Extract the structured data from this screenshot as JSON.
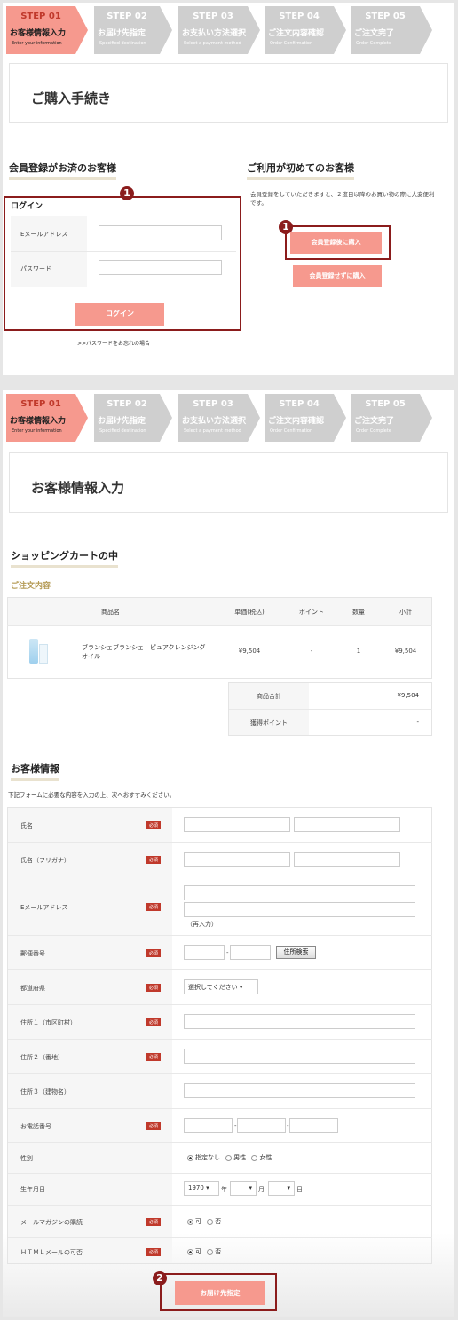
{
  "steps": [
    {
      "num": "STEP 01",
      "ja": "お客様情報入力",
      "en": "Enter your information"
    },
    {
      "num": "STEP 02",
      "ja": "お届け先指定",
      "en": "Specified destination"
    },
    {
      "num": "STEP 03",
      "ja": "お支払い方法選択",
      "en": "Select a payment method"
    },
    {
      "num": "STEP 04",
      "ja": "ご注文内容確認",
      "en": "Order Confirmation"
    },
    {
      "num": "STEP 05",
      "ja": "ご注文完了",
      "en": "Order Complete"
    }
  ],
  "colors": {
    "accent": "#f6998e",
    "highlight": "#8b1c1c",
    "underline": "#e9e2cf"
  },
  "top": {
    "title": "ご購入手続き",
    "member_heading": "会員登録がお済のお客様",
    "new_heading": "ご利用が初めてのお客様",
    "login_heading": "ログイン",
    "email_label": "Eメールアドレス",
    "password_label": "パスワード",
    "login_button": "ログイン",
    "forgot_link": ">>パスワードをお忘れの場合",
    "new_desc": "会員登録をしていただきますと、２度目以降のお買い物の際に大変便利です。",
    "register_button": "会員登録後に購入",
    "guest_button": "会員登録せずに購入",
    "badge1": "1",
    "badge2": "1"
  },
  "bottom": {
    "title": "お客様情報入力",
    "cart_heading": "ショッピングカートの中",
    "order_subheading": "ご注文内容",
    "cart_headers": [
      "商品名",
      "単価(税込)",
      "ポイント",
      "数量",
      "小計"
    ],
    "cart_item": {
      "name": "ブランシェブランシェ　ピュアクレンジングオイル",
      "price": "¥9,504",
      "points": "-",
      "qty": "1",
      "subtotal": "¥9,504"
    },
    "total_label": "商品合計",
    "total_value": "¥9,504",
    "points_label": "獲得ポイント",
    "points_value": "-",
    "customer_heading": "お客様情報",
    "instruction": "下記フォームに必要な内容を入力の上、次へおすすみください。",
    "required": "必須",
    "fields": {
      "name": "氏名",
      "kana": "氏名（フリガナ）",
      "email": "Eメールアドレス",
      "email_re": "（再入力）",
      "zip": "郵便番号",
      "zip_sep": "-",
      "zip_button": "住所検索",
      "pref": "都道府県",
      "pref_select": "選択してください",
      "addr1": "住所１（市区町村）",
      "addr2": "住所２（番地）",
      "addr3": "住所３（建物名）",
      "tel": "お電話番号",
      "tel_sep": "-",
      "gender": "性別",
      "gender_opts": [
        "指定なし",
        "男性",
        "女性"
      ],
      "birth": "生年月日",
      "birth_year": "1970",
      "birth_year_unit": "年",
      "birth_month_unit": "月",
      "birth_day_unit": "日",
      "magazine": "メールマガジンの購読",
      "html_mail": "ＨＴＭＬメールの可否",
      "yes": "可",
      "no": "否"
    },
    "next_button": "お届け先指定",
    "badge": "2"
  }
}
